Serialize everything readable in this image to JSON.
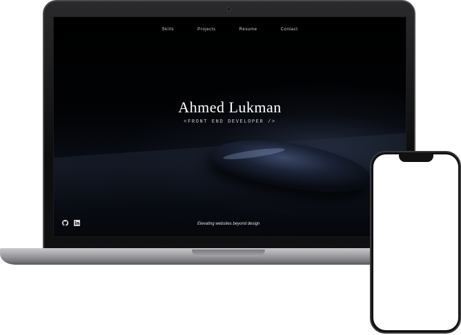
{
  "site": {
    "nav": [
      "Skills",
      "Projects",
      "Resume",
      "Contact"
    ],
    "name": "Ahmed Lukman",
    "role": "<FRONT END DEVELOPER />",
    "tagline": "Elevating websites beyond design",
    "social_icons": [
      "github-icon",
      "linkedin-icon"
    ]
  },
  "colors": {
    "screen_bg": "#000000",
    "text": "#ffffff",
    "laptop_body": "#a8a8ac",
    "phone_screen": "#ffffff"
  }
}
